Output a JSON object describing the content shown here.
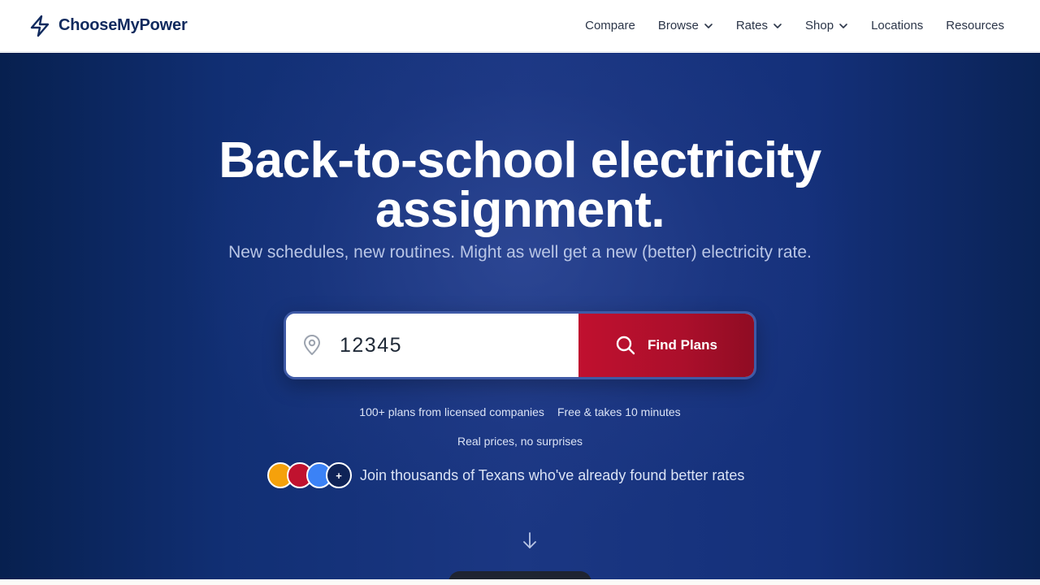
{
  "header": {
    "brand_name": "ChooseMyPower",
    "brand_icon": "lightning-bolt-icon",
    "nav": [
      {
        "label": "Compare",
        "has_dropdown": false
      },
      {
        "label": "Browse",
        "has_dropdown": true
      },
      {
        "label": "Rates",
        "has_dropdown": true
      },
      {
        "label": "Shop",
        "has_dropdown": true
      },
      {
        "label": "Locations",
        "has_dropdown": false
      },
      {
        "label": "Resources",
        "has_dropdown": false
      }
    ]
  },
  "hero": {
    "title_line1": "Back-to-school electricity",
    "title_line2": "assignment.",
    "subtitle": "New schedules, new routines. Might as well get a new (better) electricity rate.",
    "search": {
      "zip_value": "12345",
      "pin_icon": "location-pin-icon",
      "button_label": "Find Plans",
      "button_icon": "search-icon"
    },
    "features": [
      "100+ plans from licensed companies",
      "Free & takes 10 minutes"
    ],
    "features_line2": "Real prices, no surprises",
    "social_proof": {
      "text": "Join thousands of Texans who've already found better rates",
      "avatar_colors": [
        "#f5a10b",
        "#c0122f",
        "#3b82f6"
      ],
      "plus_label": "+"
    },
    "scroll_icon": "arrow-down-icon"
  },
  "colors": {
    "brand_navy": "#0f2a5e",
    "hero_bg": "#14307a",
    "cta_red": "#c0102f",
    "subtitle": "#b9c6e6"
  }
}
